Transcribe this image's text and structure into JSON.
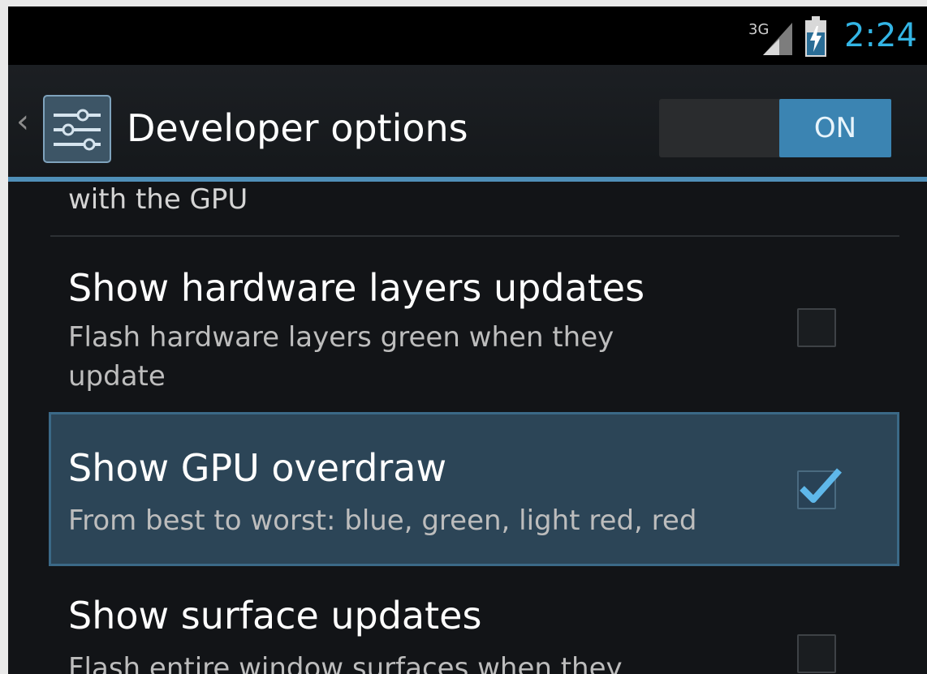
{
  "status_bar": {
    "network_label": "3G",
    "time": "2:24"
  },
  "action_bar": {
    "title": "Developer options",
    "toggle_label": "ON",
    "toggle_state": "on"
  },
  "list": {
    "cut_off_summary": "with the GPU",
    "items": [
      {
        "title": "Show hardware layers updates",
        "summary": "Flash hardware layers green when they update",
        "checked": false,
        "highlighted": false
      },
      {
        "title": "Show GPU overdraw",
        "summary": "From best to worst: blue, green, light red, red",
        "checked": true,
        "highlighted": true
      },
      {
        "title": "Show surface updates",
        "summary": "Flash entire window surfaces when they",
        "checked": false,
        "highlighted": false
      }
    ]
  },
  "colors": {
    "accent": "#33b5e5",
    "toggle_on": "#3b84b2",
    "highlight": "#2c4557",
    "background": "#121417"
  },
  "icons": {
    "back": "chevron-left-icon",
    "app": "settings-sliders-icon",
    "signal": "signal-3g-icon",
    "battery": "battery-charging-icon",
    "check": "checkmark-icon"
  }
}
